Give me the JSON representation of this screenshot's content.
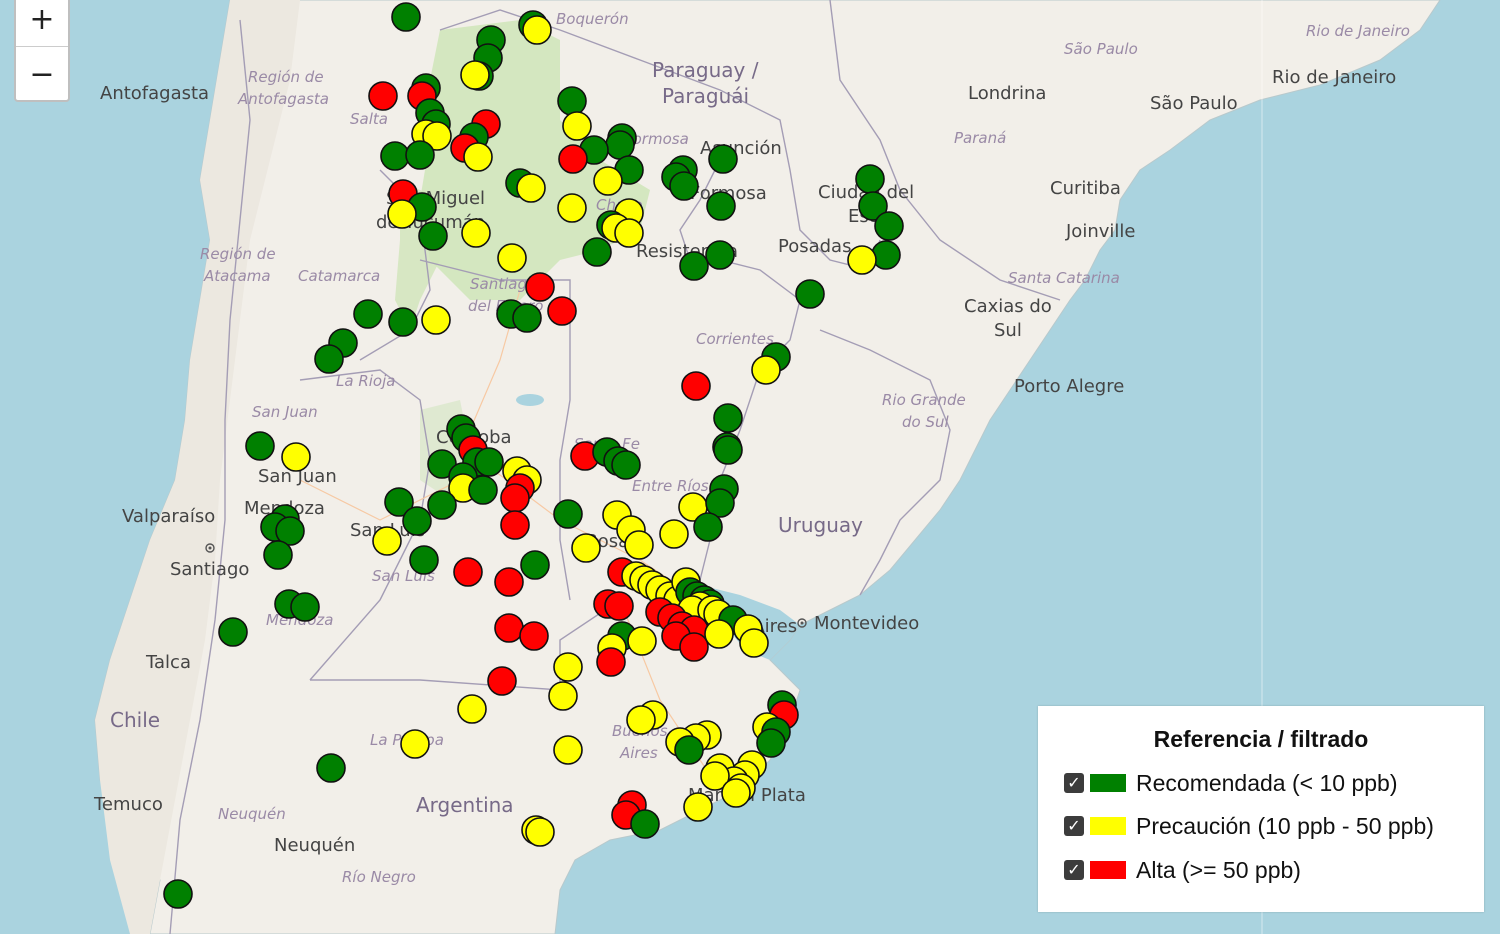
{
  "zoom": {
    "in_label": "+",
    "out_label": "−"
  },
  "colors": {
    "green": "#008000",
    "yellow": "#ffff00",
    "red": "#ff0000",
    "water": "#aad3df",
    "land": "#f2efe9",
    "forest": "#cfe5b9",
    "border": "#a49db5"
  },
  "map_labels": [
    {
      "id": "antofagasta",
      "text": "Antofagasta"
    },
    {
      "id": "region-antofagasta-1",
      "text": "Región de"
    },
    {
      "id": "region-antofagasta-2",
      "text": "Antofagasta"
    },
    {
      "id": "salta",
      "text": "Salta"
    },
    {
      "id": "boqueron",
      "text": "Boquerón"
    },
    {
      "id": "paraguay-1",
      "text": "Paraguay /"
    },
    {
      "id": "paraguay-2",
      "text": "Paraguái"
    },
    {
      "id": "formosa-prov",
      "text": "Formosa"
    },
    {
      "id": "asuncion",
      "text": "Asunción"
    },
    {
      "id": "formosa-city",
      "text": "Formosa"
    },
    {
      "id": "londrina",
      "text": "Londrina"
    },
    {
      "id": "sao-paulo-state",
      "text": "São Paulo"
    },
    {
      "id": "sao-paulo-city",
      "text": "São Paulo"
    },
    {
      "id": "rio-state",
      "text": "Rio de Janeiro"
    },
    {
      "id": "rio-city",
      "text": "Rio de Janeiro"
    },
    {
      "id": "parana",
      "text": "Paraná"
    },
    {
      "id": "curitiba",
      "text": "Curitiba"
    },
    {
      "id": "joinville",
      "text": "Joinville"
    },
    {
      "id": "ciudad-del-este-1",
      "text": "Ciudad del"
    },
    {
      "id": "ciudad-del-este-2",
      "text": "Este"
    },
    {
      "id": "san-miguel-1",
      "text": "San Miguel"
    },
    {
      "id": "san-miguel-2",
      "text": "de Tucumán"
    },
    {
      "id": "chaco",
      "text": "Chaco"
    },
    {
      "id": "resistencia",
      "text": "Resistencia"
    },
    {
      "id": "posadas",
      "text": "Posadas"
    },
    {
      "id": "santa-catarina",
      "text": "Santa Catarina"
    },
    {
      "id": "caxias-1",
      "text": "Caxias do"
    },
    {
      "id": "caxias-2",
      "text": "Sul"
    },
    {
      "id": "region-atacama-1",
      "text": "Región de"
    },
    {
      "id": "region-atacama-2",
      "text": "Atacama"
    },
    {
      "id": "catamarca",
      "text": "Catamarca"
    },
    {
      "id": "santiago-estero-1",
      "text": "Santiago"
    },
    {
      "id": "santiago-estero-2",
      "text": "del Estero"
    },
    {
      "id": "corrientes",
      "text": "Corrientes"
    },
    {
      "id": "porto-alegre",
      "text": "Porto Alegre"
    },
    {
      "id": "la-rioja",
      "text": "La Rioja"
    },
    {
      "id": "rio-grande-1",
      "text": "Rio Grande"
    },
    {
      "id": "rio-grande-2",
      "text": "do Sul"
    },
    {
      "id": "san-juan-prov",
      "text": "San Juan"
    },
    {
      "id": "cordoba",
      "text": "Córdoba"
    },
    {
      "id": "santa-fe",
      "text": "Santa Fe"
    },
    {
      "id": "san-juan-city",
      "text": "San Juan"
    },
    {
      "id": "entre-rios",
      "text": "Entre Ríos"
    },
    {
      "id": "valparaiso",
      "text": "Valparaíso"
    },
    {
      "id": "mendoza-city",
      "text": "Mendoza"
    },
    {
      "id": "san-luis-city",
      "text": "San Luis"
    },
    {
      "id": "uruguay",
      "text": "Uruguay"
    },
    {
      "id": "rosario",
      "text": "Rosario"
    },
    {
      "id": "santiago",
      "text": "Santiago"
    },
    {
      "id": "san-luis-prov",
      "text": "San Luis"
    },
    {
      "id": "mendoza-prov",
      "text": "Mendoza"
    },
    {
      "id": "buenos-aires-city",
      "text": "Buenos Aires"
    },
    {
      "id": "montevideo",
      "text": "Montevideo"
    },
    {
      "id": "talca",
      "text": "Talca"
    },
    {
      "id": "chile",
      "text": "Chile"
    },
    {
      "id": "la-pampa",
      "text": "La Pampa"
    },
    {
      "id": "buenos-aires-prov-1",
      "text": "Buenos"
    },
    {
      "id": "buenos-aires-prov-2",
      "text": "Aires"
    },
    {
      "id": "temuco",
      "text": "Temuco"
    },
    {
      "id": "neuquen-prov",
      "text": "Neuquén"
    },
    {
      "id": "argentina",
      "text": "Argentina"
    },
    {
      "id": "mar-del-plata",
      "text": "Mar del Plata"
    },
    {
      "id": "neuquen-city",
      "text": "Neuquén"
    },
    {
      "id": "rio-negro",
      "text": "Río Negro"
    }
  ],
  "legend": {
    "title": "Referencia / filtrado",
    "items": [
      {
        "label": "Recomendada (< 10 ppb)",
        "color": "#008000",
        "checked": true
      },
      {
        "label": "Precaución (10 ppb - 50 ppb)",
        "color": "#ffff00",
        "checked": true
      },
      {
        "label": "Alta (>= 50 ppb)",
        "color": "#ff0000",
        "checked": true
      }
    ]
  }
}
